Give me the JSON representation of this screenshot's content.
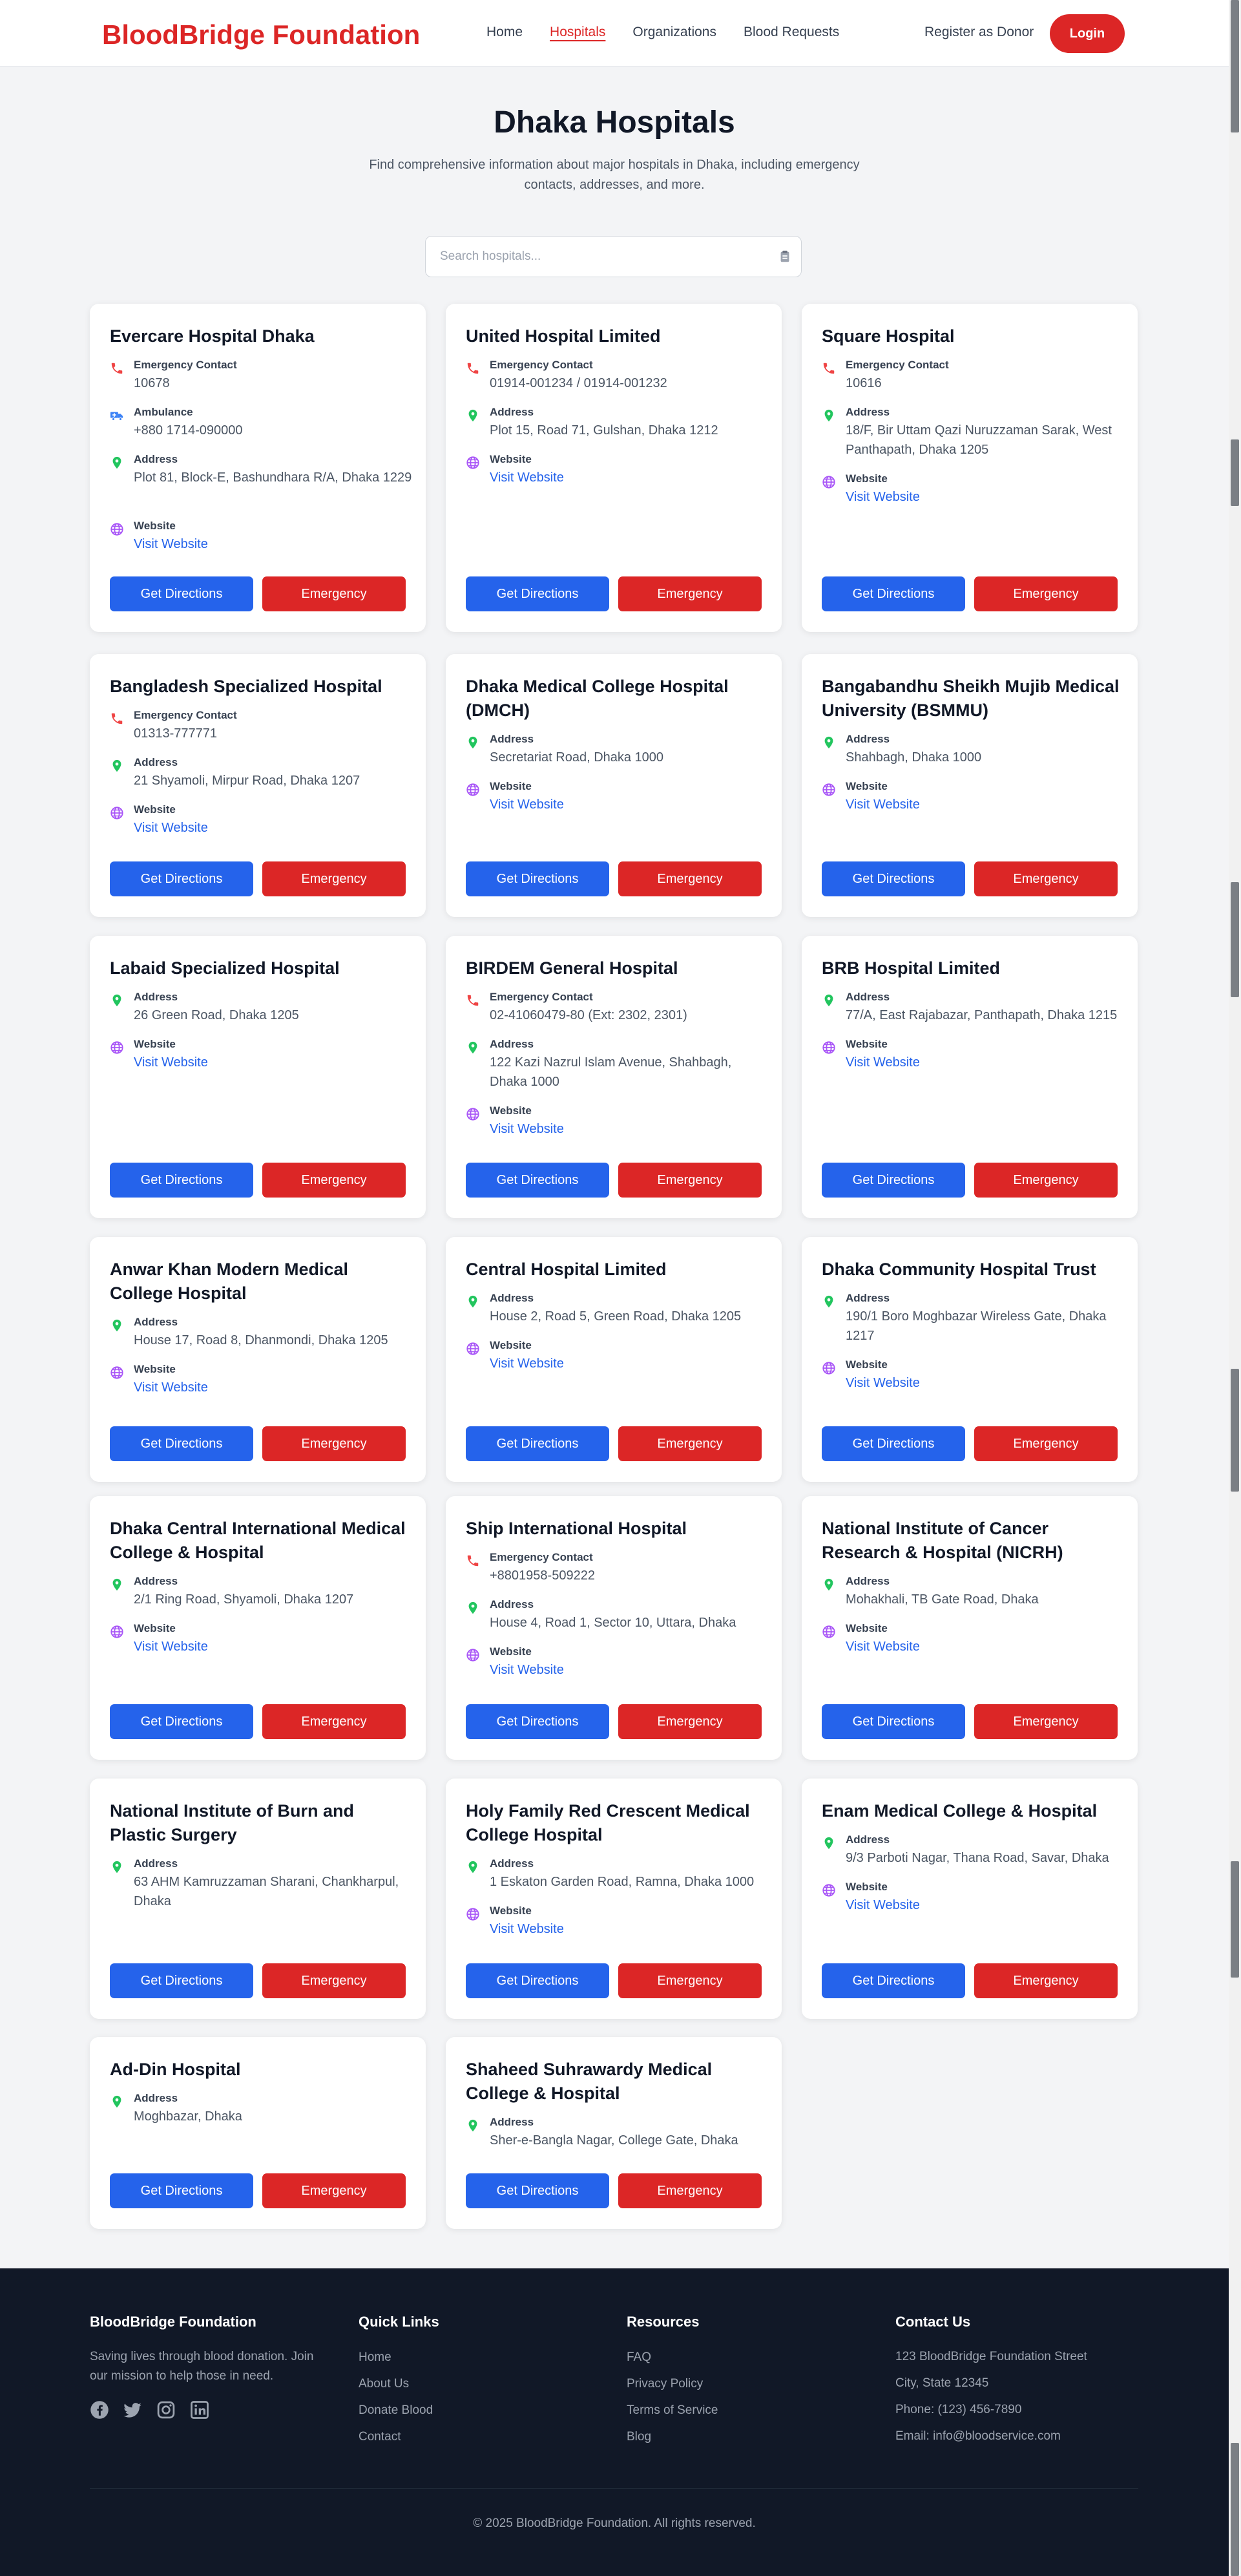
{
  "header": {
    "brand": "BloodBridge Foundation",
    "nav": [
      "Home",
      "Hospitals",
      "Organizations",
      "Blood Requests"
    ],
    "active_nav": "Hospitals",
    "register": "Register as Donor",
    "login": "Login"
  },
  "hero": {
    "title": "Dhaka Hospitals",
    "subtitle": "Find comprehensive information about major hospitals in Dhaka, including emergency contacts, addresses, and more.",
    "search_placeholder": "Search hospitals...",
    "search_value": ""
  },
  "buttons": {
    "directions": "Get Directions",
    "emergency": "Emergency"
  },
  "labels": {
    "emergency": "Emergency Contact",
    "ambulance": "Ambulance",
    "address": "Address",
    "website": "Website",
    "visit": "Visit Website"
  },
  "hospitals": [
    {
      "name": "Evercare Hospital Dhaka",
      "emergency": "10678",
      "ambulance": "+880 1714-090000",
      "address": "Plot 81, Block-E, Bashundhara R/A, Dhaka 1229",
      "website": true
    },
    {
      "name": "United Hospital Limited",
      "emergency": "01914-001234 / 01914-001232",
      "address": "Plot 15, Road 71, Gulshan, Dhaka 1212",
      "website": true
    },
    {
      "name": "Square Hospital",
      "emergency": "10616",
      "address": "18/F, Bir Uttam Qazi Nuruzzaman Sarak, West Panthapath, Dhaka 1205",
      "website": true
    },
    {
      "name": "Bangladesh Specialized Hospital",
      "emergency": "01313-777771",
      "address": "21 Shyamoli, Mirpur Road, Dhaka 1207",
      "website": true
    },
    {
      "name": "Dhaka Medical College Hospital (DMCH)",
      "address": "Secretariat Road, Dhaka 1000",
      "website": true
    },
    {
      "name": "Bangabandhu Sheikh Mujib Medical University (BSMMU)",
      "address": "Shahbagh, Dhaka 1000",
      "website": true
    },
    {
      "name": "Labaid Specialized Hospital",
      "address": "26 Green Road, Dhaka 1205",
      "website": true
    },
    {
      "name": "BIRDEM General Hospital",
      "emergency": "02-41060479-80 (Ext: 2302, 2301)",
      "address": "122 Kazi Nazrul Islam Avenue, Shahbagh, Dhaka 1000",
      "website": true
    },
    {
      "name": "BRB Hospital Limited",
      "address": "77/A, East Rajabazar, Panthapath, Dhaka 1215",
      "website": true
    },
    {
      "name": "Anwar Khan Modern Medical College Hospital",
      "address": "House 17, Road 8, Dhanmondi, Dhaka 1205",
      "website": true
    },
    {
      "name": "Central Hospital Limited",
      "address": "House 2, Road 5, Green Road, Dhaka 1205",
      "website": true
    },
    {
      "name": "Dhaka Community Hospital Trust",
      "address": "190/1 Boro Moghbazar Wireless Gate, Dhaka 1217",
      "website": true
    },
    {
      "name": "Dhaka Central International Medical College & Hospital",
      "address": "2/1 Ring Road, Shyamoli, Dhaka 1207",
      "website": true
    },
    {
      "name": "Ship International Hospital",
      "emergency": "+8801958-509222",
      "address": "House 4, Road 1, Sector 10, Uttara, Dhaka",
      "website": true
    },
    {
      "name": "National Institute of Cancer Research & Hospital (NICRH)",
      "address": "Mohakhali, TB Gate Road, Dhaka",
      "website": true
    },
    {
      "name": "National Institute of Burn and Plastic Surgery",
      "address": "63 AHM Kamruzzaman Sharani, Chankharpul, Dhaka",
      "website": false
    },
    {
      "name": "Holy Family Red Crescent Medical College Hospital",
      "address": "1 Eskaton Garden Road, Ramna, Dhaka 1000",
      "website": true
    },
    {
      "name": "Enam Medical College & Hospital",
      "address": "9/3 Parboti Nagar, Thana Road, Savar, Dhaka",
      "website": true
    },
    {
      "name": "Ad-Din Hospital",
      "address": "Moghbazar, Dhaka",
      "website": false
    },
    {
      "name": "Shaheed Suhrawardy Medical College & Hospital",
      "address": "Sher-e-Bangla Nagar, College Gate, Dhaka",
      "website": false
    }
  ],
  "footer": {
    "about_title": "BloodBridge Foundation",
    "about_text": "Saving lives through blood donation. Join our mission to help those in need.",
    "quick_title": "Quick Links",
    "quick_links": [
      "Home",
      "About Us",
      "Donate Blood",
      "Contact"
    ],
    "resources_title": "Resources",
    "resources_links": [
      "FAQ",
      "Privacy Policy",
      "Terms of Service",
      "Blog"
    ],
    "contact_title": "Contact Us",
    "contact_lines": [
      "123 BloodBridge Foundation Street",
      "City, State 12345",
      "Phone: (123) 456-7890",
      "Email: info@bloodservice.com"
    ],
    "social": [
      "facebook-icon",
      "twitter-icon",
      "instagram-icon",
      "linkedin-icon"
    ],
    "copyright": "© 2025 BloodBridge Foundation. All rights reserved."
  },
  "colors": {
    "brand": "#dc2626",
    "primary": "#2563eb",
    "phone_icon": "#ef4444",
    "ambulance_icon": "#3b82f6",
    "address_icon": "#22c55e",
    "website_icon": "#a855f7"
  }
}
